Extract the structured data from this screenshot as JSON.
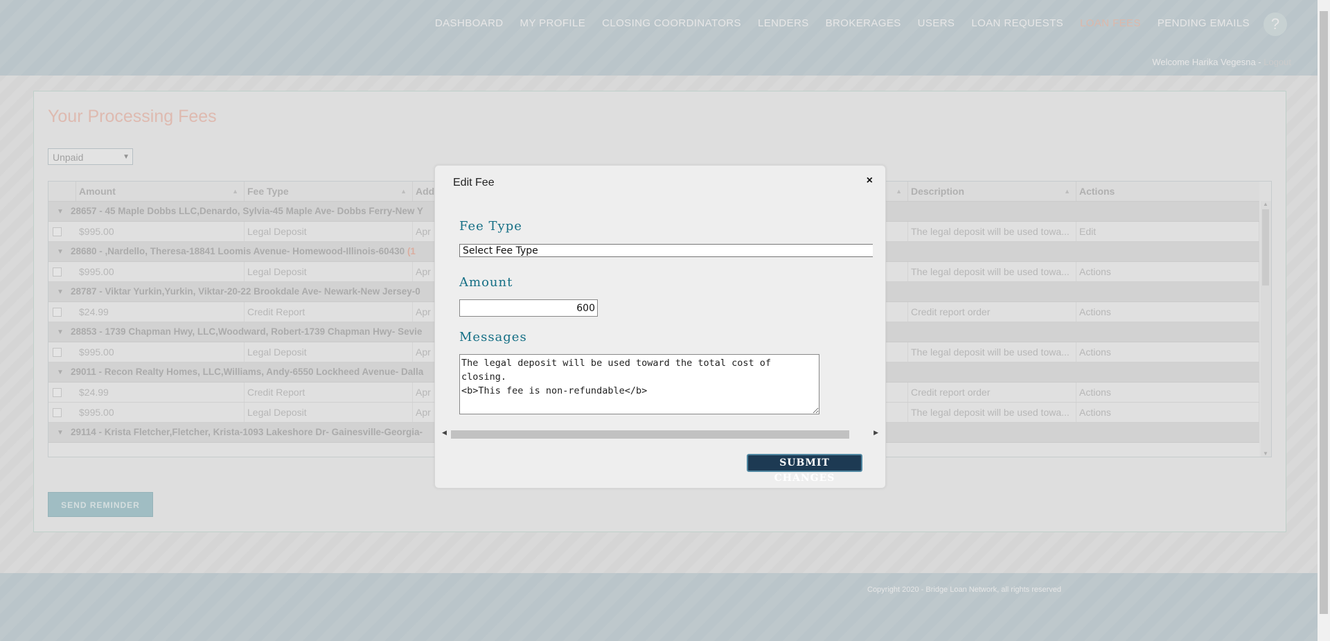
{
  "nav": {
    "items": [
      {
        "label": "DASHBOARD"
      },
      {
        "label": "MY PROFILE"
      },
      {
        "label": "CLOSING COORDINATORS"
      },
      {
        "label": "LENDERS"
      },
      {
        "label": "BROKERAGES"
      },
      {
        "label": "USERS"
      },
      {
        "label": "LOAN REQUESTS"
      },
      {
        "label": "LOAN FEES"
      },
      {
        "label": "PENDING EMAILS"
      }
    ],
    "help_label": "?",
    "welcome": "Welcome Harika Vegesna - ",
    "logout": "Logout"
  },
  "page": {
    "title": "Your Processing Fees",
    "filter_value": "Unpaid",
    "send_reminder": "SEND REMINDER"
  },
  "grid": {
    "columns": [
      "Amount",
      "Fee Type",
      "Add",
      "Description",
      "Actions"
    ],
    "groups": [
      {
        "text": "28657 - 45 Maple Dobbs LLC,Denardo, Sylvia-45 Maple Ave- Dobbs Ferry-New Y",
        "count": "",
        "rows": [
          {
            "amount": "$995.00",
            "fee_type": "Legal Deposit",
            "added": "Apr",
            "description": "The legal deposit will be used towa...",
            "action": "Edit"
          }
        ]
      },
      {
        "text": "28680 - ,Nardello, Theresa-18841 Loomis Avenue- Homewood-Illinois-60430",
        "count": "(1",
        "rows": [
          {
            "amount": "$995.00",
            "fee_type": "Legal Deposit",
            "added": "Apr",
            "description": "The legal deposit will be used towa...",
            "action": "Actions"
          }
        ]
      },
      {
        "text": "28787 - Viktar Yurkin,Yurkin, Viktar-20-22 Brookdale Ave- Newark-New Jersey-0",
        "count": "",
        "rows": [
          {
            "amount": "$24.99",
            "fee_type": "Credit Report",
            "added": "Apr",
            "description": "Credit report order",
            "action": "Actions"
          }
        ]
      },
      {
        "text": "28853 - 1739 Chapman Hwy, LLC,Woodward, Robert-1739 Chapman Hwy- Sevie",
        "count": "",
        "rows": [
          {
            "amount": "$995.00",
            "fee_type": "Legal Deposit",
            "added": "Apr",
            "description": "The legal deposit will be used towa...",
            "action": "Actions"
          }
        ]
      },
      {
        "text": "29011 - Recon Realty Homes, LLC,Williams, Andy-6550 Lockheed Avenue- Dalla",
        "count": "",
        "rows": [
          {
            "amount": "$24.99",
            "fee_type": "Credit Report",
            "added": "Apr",
            "description": "Credit report order",
            "action": "Actions"
          },
          {
            "amount": "$995.00",
            "fee_type": "Legal Deposit",
            "added": "Apr",
            "description": "The legal deposit will be used towa...",
            "action": "Actions"
          }
        ]
      },
      {
        "text": "29114 - Krista Fletcher,Fletcher, Krista-1093 Lakeshore Dr- Gainesville-Georgia-",
        "count": "",
        "rows": []
      }
    ]
  },
  "modal": {
    "title": "Edit Fee",
    "close": "×",
    "fee_type_label": "Fee Type",
    "fee_type_value": "Select Fee Type",
    "amount_label": "Amount",
    "amount_value": "600",
    "messages_label": "Messages",
    "messages_value": "The legal deposit will be used toward the total cost of closing.\n<b>This fee is non-refundable</b>",
    "submit": "SUBMIT CHANGES"
  },
  "footer": {
    "copyright": "Copyright 2020 - Bridge Loan Network, all rights reserved"
  },
  "colors": {
    "header_bg": "#c9d6dc",
    "active_nav": "#f1c6b6",
    "title_accent": "#f4c8bc",
    "modal_label": "#156f85",
    "submit_bg": "#1d3a53"
  }
}
